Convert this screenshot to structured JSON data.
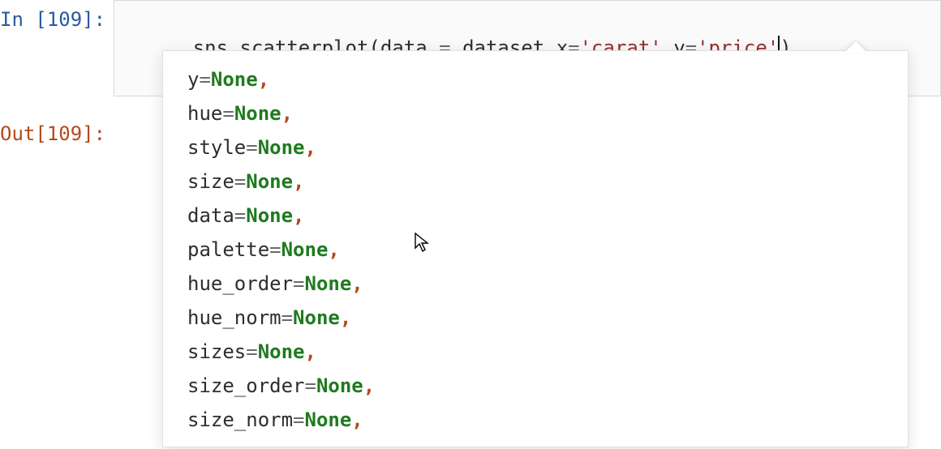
{
  "cell_number": "109",
  "in_prompt": "In [109]:",
  "out_prompt": "Out[109]:",
  "code": {
    "obj": "sns",
    "dot": ".",
    "func": "scatterplot",
    "open": "(",
    "p1": "data",
    "eq1": " = ",
    "v1": "dataset",
    "c1": ",",
    "p2": "x",
    "eq2": "=",
    "v2": "'carat'",
    "c2": ",",
    "p3": "y",
    "eq3": "=",
    "v3": "'price'",
    "close": ")"
  },
  "signature": [
    {
      "param": "y",
      "eq": "=",
      "val": "None",
      "comma": ","
    },
    {
      "param": "hue",
      "eq": "=",
      "val": "None",
      "comma": ","
    },
    {
      "param": "style",
      "eq": "=",
      "val": "None",
      "comma": ","
    },
    {
      "param": "size",
      "eq": "=",
      "val": "None",
      "comma": ","
    },
    {
      "param": "data",
      "eq": "=",
      "val": "None",
      "comma": ","
    },
    {
      "param": "palette",
      "eq": "=",
      "val": "None",
      "comma": ","
    },
    {
      "param": "hue_order",
      "eq": "=",
      "val": "None",
      "comma": ","
    },
    {
      "param": "hue_norm",
      "eq": "=",
      "val": "None",
      "comma": ","
    },
    {
      "param": "sizes",
      "eq": "=",
      "val": "None",
      "comma": ","
    },
    {
      "param": "size_order",
      "eq": "=",
      "val": "None",
      "comma": ","
    },
    {
      "param": "size_norm",
      "eq": "=",
      "val": "None",
      "comma": ","
    }
  ]
}
